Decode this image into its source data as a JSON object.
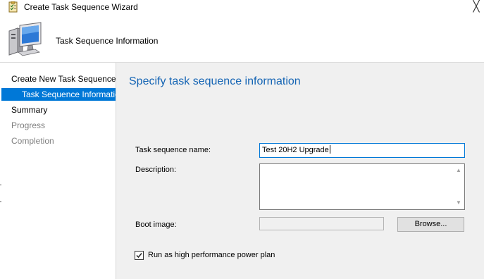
{
  "window": {
    "title": "Create Task Sequence Wizard",
    "close_glyph": "╳"
  },
  "header": {
    "title": "Task Sequence Information",
    "icon": "computer-icon"
  },
  "nav": {
    "items": [
      {
        "label": "Create New Task Sequence",
        "state": "normal"
      },
      {
        "label": "Task Sequence Information",
        "state": "selected"
      },
      {
        "label": "Summary",
        "state": "normal"
      },
      {
        "label": "Progress",
        "state": "disabled"
      },
      {
        "label": "Completion",
        "state": "disabled"
      }
    ]
  },
  "content": {
    "heading": "Specify task sequence information",
    "name_label": "Task sequence name:",
    "name_value": "Test 20H2 Upgrade",
    "description_label": "Description:",
    "description_value": "",
    "boot_image_label": "Boot image:",
    "boot_image_value": "",
    "browse_button": "Browse...",
    "power_plan_label": "Run as high performance power plan",
    "power_plan_checked": true
  },
  "colors": {
    "accent": "#0078d7",
    "heading": "#1464b4",
    "panel": "#f0f0f0"
  }
}
